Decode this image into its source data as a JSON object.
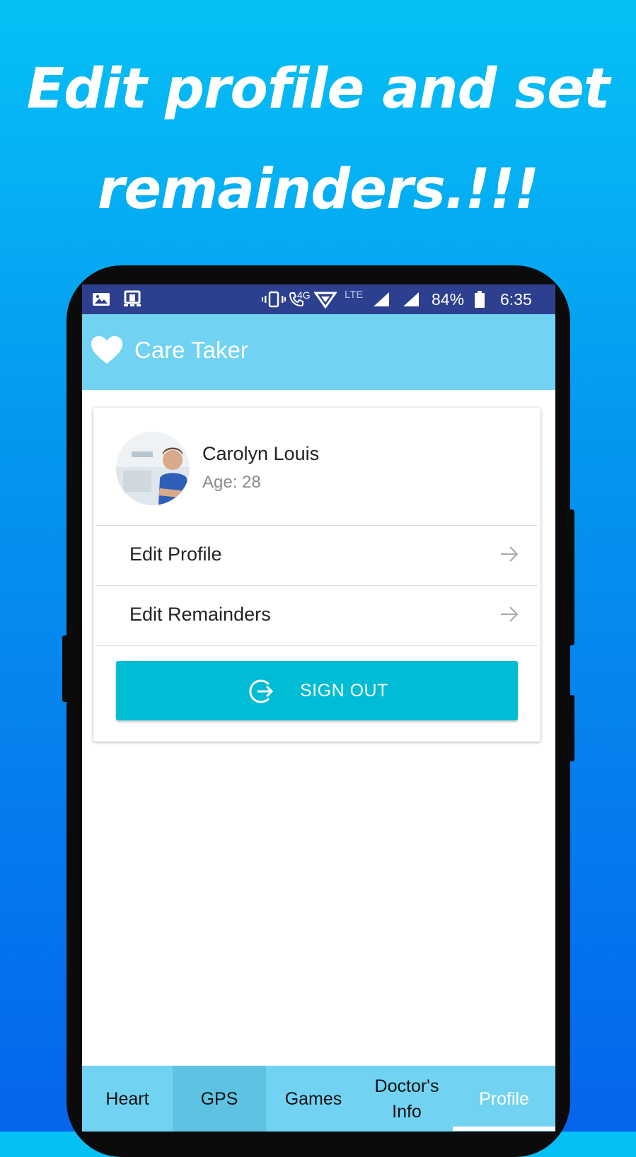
{
  "headline": {
    "line1": "Edit profile and set",
    "line2": "remainders.!!!"
  },
  "status_bar": {
    "network": "4G",
    "lte": "LTE",
    "battery": "84%",
    "time": "6:35",
    "icons": [
      "image-icon",
      "screen-cast-icon",
      "vibrate-icon",
      "wifi-calling-icon",
      "data-icon",
      "signal-icon",
      "signal-icon",
      "battery-icon"
    ]
  },
  "app_bar": {
    "icon": "heart-icon",
    "title": "Care Taker"
  },
  "profile": {
    "name": "Carolyn Louis",
    "age": "Age: 28"
  },
  "menu": {
    "items": [
      {
        "label": "Edit Profile",
        "icon": "arrow-right-icon"
      },
      {
        "label": "Edit Remainders",
        "icon": "arrow-right-icon"
      }
    ]
  },
  "sign_out": {
    "label": "SIGN OUT",
    "icon": "logout-icon"
  },
  "tabs": [
    {
      "label": "Heart"
    },
    {
      "label": "GPS"
    },
    {
      "label": "Games"
    },
    {
      "label": "Doctor's\nInfo"
    },
    {
      "label": "Profile"
    }
  ],
  "colors": {
    "status_bar": "#2d3f8f",
    "app_bar": "#71d3f1",
    "accent_button": "#00bcd4",
    "background_top": "#05c1f5",
    "background_bottom": "#0565ec"
  }
}
